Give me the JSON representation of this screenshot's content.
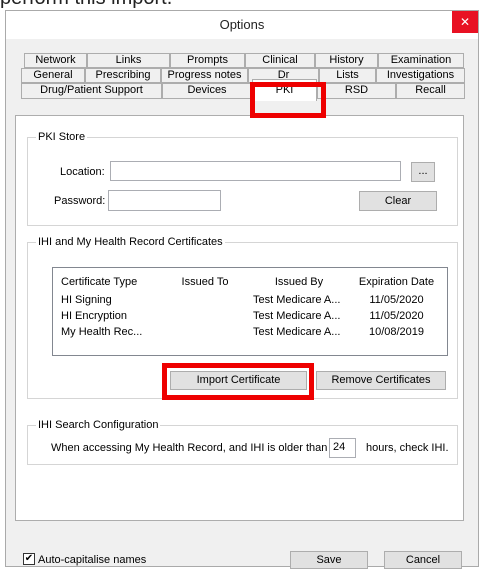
{
  "caption": "perform this import.",
  "window": {
    "title": "Options",
    "close_glyph": "✕"
  },
  "tabs": {
    "row1": [
      "Network",
      "Links",
      "Prompts",
      "Clinical",
      "History",
      "Examination"
    ],
    "row2": [
      "General",
      "Prescribing",
      "Progress notes",
      "Dr",
      "Lists",
      "Investigations"
    ],
    "row3": [
      "Drug/Patient Support",
      "Devices",
      "PKI",
      "RSD",
      "Recall"
    ],
    "active": "PKI"
  },
  "pki_store": {
    "title": "PKI Store",
    "location_label": "Location:",
    "location_value": "",
    "browse_label": "...",
    "password_label": "Password:",
    "password_value": "",
    "clear_label": "Clear"
  },
  "certificates": {
    "title": "IHI and My Health Record Certificates",
    "columns": [
      "Certificate Type",
      "Issued To",
      "Issued By",
      "Expiration Date"
    ],
    "rows": [
      [
        "HI Signing",
        "",
        "Test Medicare A...",
        "11/05/2020"
      ],
      [
        "HI Encryption",
        "",
        "Test Medicare A...",
        "11/05/2020"
      ],
      [
        "My Health Rec...",
        "",
        "Test Medicare A...",
        "10/08/2019"
      ]
    ],
    "import_label": "Import Certificate",
    "remove_label": "Remove Certificates"
  },
  "ihi_search": {
    "title": "IHI Search Configuration",
    "prefix": "When accessing My Health Record, and IHI is older than",
    "hours_value": "24",
    "suffix": "hours, check IHI."
  },
  "footer": {
    "autocap_label": "Auto-capitalise names",
    "autocap_checked": true,
    "save_label": "Save",
    "cancel_label": "Cancel"
  }
}
